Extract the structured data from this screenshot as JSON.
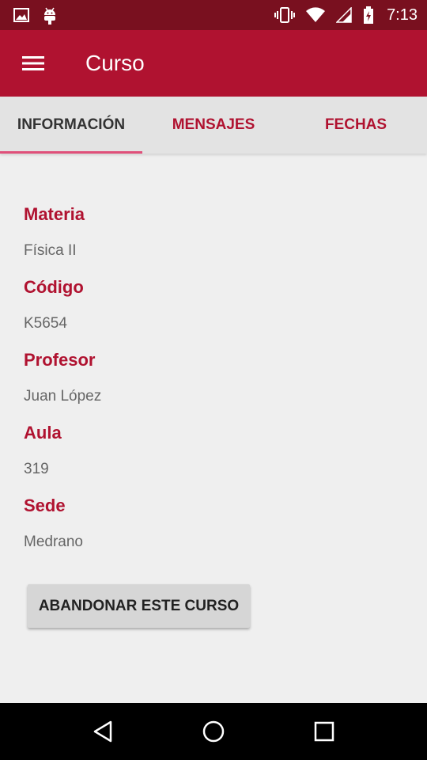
{
  "status_bar": {
    "time": "7:13",
    "left_icons": [
      "image-icon",
      "android-icon"
    ],
    "right_icons": [
      "vibrate-icon",
      "wifi-icon",
      "signal-icon",
      "battery-icon"
    ]
  },
  "app_bar": {
    "title": "Curso",
    "menu_icon": "menu-icon"
  },
  "tabs": [
    {
      "label": "INFORMACIÓN",
      "active": true
    },
    {
      "label": "MENSAJES",
      "active": false
    },
    {
      "label": "FECHAS",
      "active": false
    }
  ],
  "fields": [
    {
      "label": "Materia",
      "value": "Física II"
    },
    {
      "label": "Código",
      "value": "K5654"
    },
    {
      "label": "Profesor",
      "value": "Juan López"
    },
    {
      "label": "Aula",
      "value": "319"
    },
    {
      "label": "Sede",
      "value": "Medrano"
    }
  ],
  "actions": {
    "abandon_label": "ABANDONAR ESTE CURSO"
  },
  "nav_bar": {
    "icons": [
      "back-icon",
      "home-icon",
      "recents-icon"
    ]
  },
  "colors": {
    "status_bar": "#79101f",
    "primary": "#b01230",
    "tab_indicator": "#e0507a",
    "background": "#efefef"
  }
}
